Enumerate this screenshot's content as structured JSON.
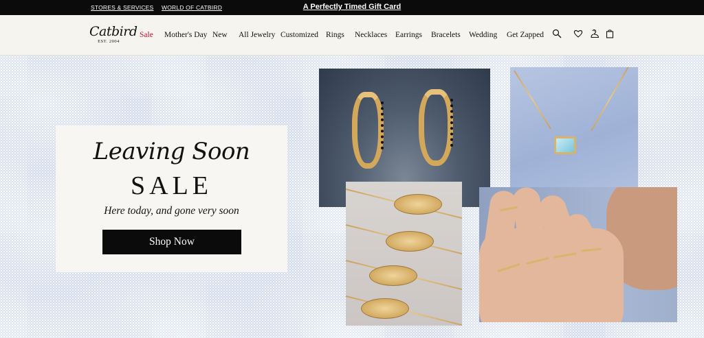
{
  "topbar": {
    "links": [
      "STORES & SERVICES",
      "WORLD OF CATBIRD"
    ],
    "promo": "A Perfectly Timed Gift Card"
  },
  "header": {
    "logo_script": "Catbird",
    "logo_est": "EST. 2004",
    "nav": [
      "Sale",
      "Mother's Day",
      "New",
      "All Jewelry",
      "Customized",
      "Rings",
      "Necklaces",
      "Earrings",
      "Bracelets",
      "Wedding",
      "Get Zapped"
    ],
    "icons": [
      "search-icon",
      "heart-icon",
      "account-icon",
      "bag-icon"
    ],
    "sale_color": "#c8102e"
  },
  "hero": {
    "script_title": "Leaving Soon",
    "title": "SALE",
    "subtitle": "Here today, and gone very soon",
    "cta": "Shop Now"
  }
}
